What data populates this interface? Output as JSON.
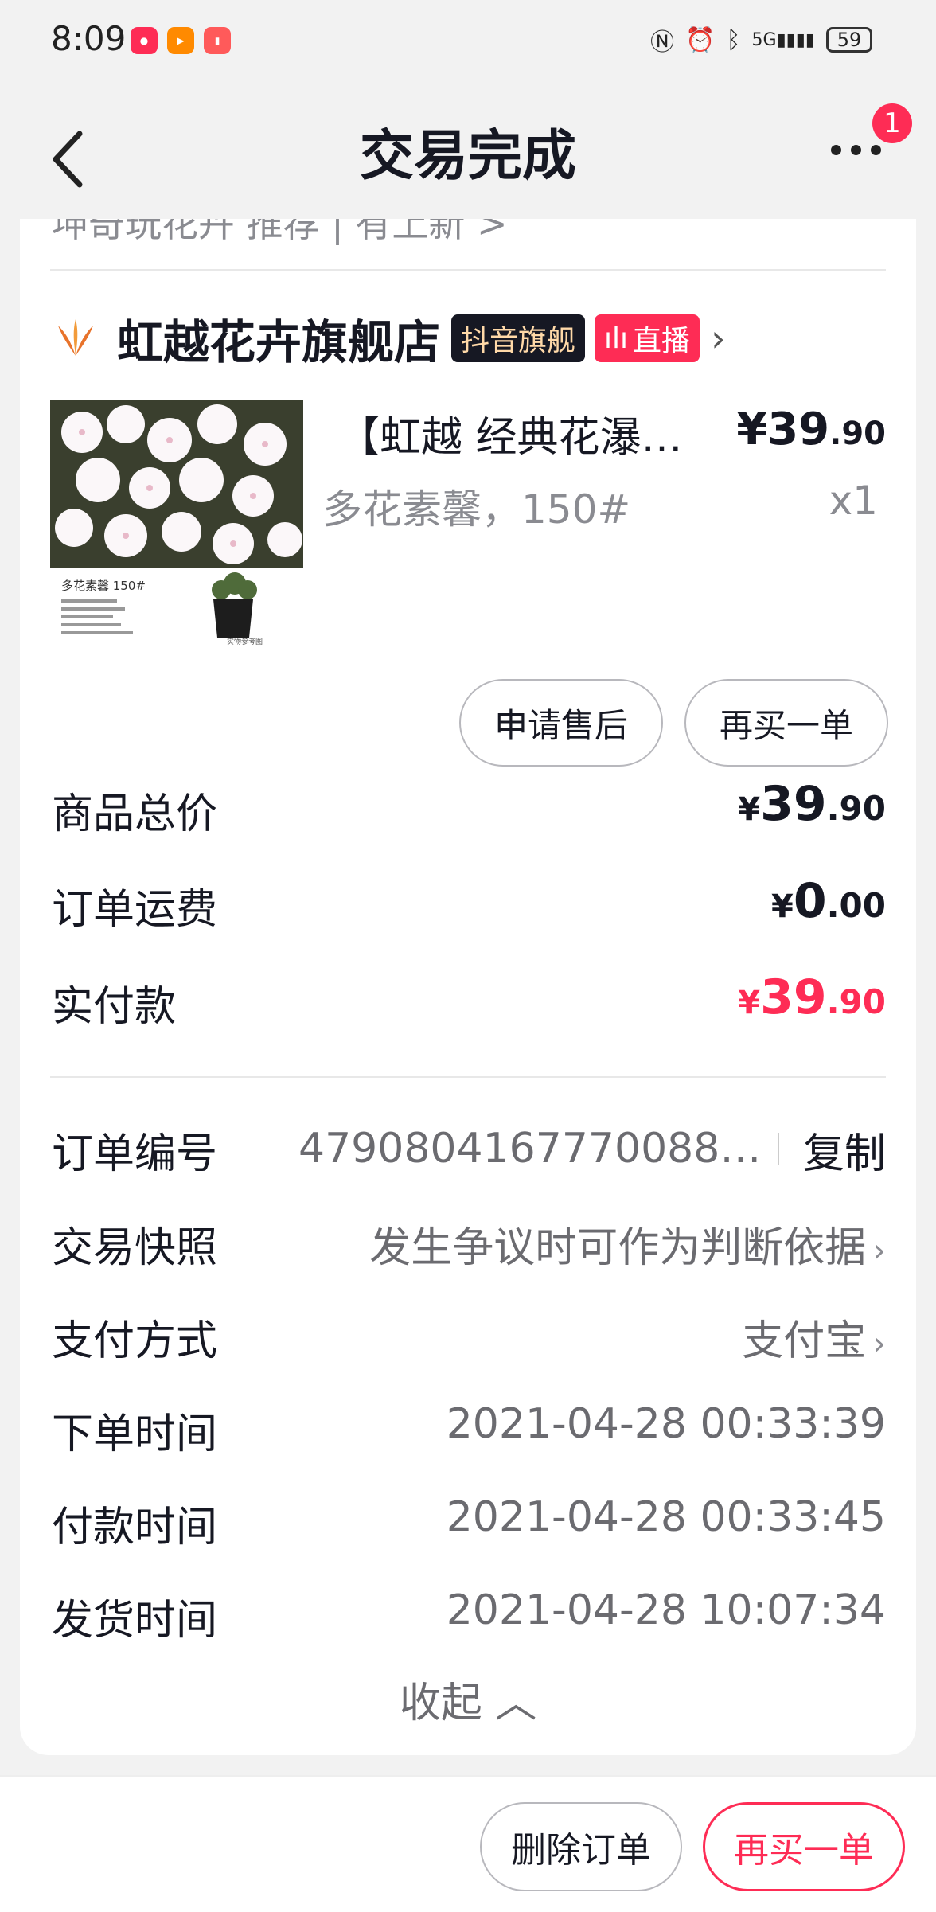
{
  "status_bar": {
    "time": "8:09",
    "battery": "59",
    "app_icons": [
      "red-app-icon",
      "video-app-icon",
      "book-app-icon"
    ],
    "sys_icons": [
      "nfc-icon",
      "alarm-icon",
      "bluetooth-icon",
      "signal-5g-icon"
    ],
    "signal_label": "5G"
  },
  "nav": {
    "title": "交易完成",
    "badge_count": "1"
  },
  "cut_row": "坤奇玩花卉 推荐 | 有上新 >",
  "shop": {
    "name": "虹越花卉旗舰店",
    "flag_tag": "抖音旗舰",
    "live_tag": "直播",
    "accent": "#fe2c55"
  },
  "product": {
    "title": "【虹越 经典花瀑…",
    "price_int": "¥39",
    "price_dec": ".90",
    "spec": "多花素馨，150#",
    "qty": "x1",
    "img_label": "多花素馨 150#",
    "img_note": "实物参考图"
  },
  "actions": {
    "after_sale": "申请售后",
    "buy_again": "再买一单"
  },
  "summary": [
    {
      "label": "商品总价",
      "yen": "¥",
      "int": "39",
      "dec": ".90"
    },
    {
      "label": "订单运费",
      "yen": "¥",
      "int": "0",
      "dec": ".00"
    },
    {
      "label": "实付款",
      "yen": "¥",
      "int": "39",
      "dec": ".90"
    }
  ],
  "info": {
    "order_no_label": "订单编号",
    "order_no": "4790804167770088…",
    "copy": "复制",
    "snapshot_label": "交易快照",
    "snapshot_value": "发生争议时可作为判断依据",
    "pay_method_label": "支付方式",
    "pay_method": "支付宝",
    "order_time_label": "下单时间",
    "order_time": "2021-04-28 00:33:39",
    "pay_time_label": "付款时间",
    "pay_time": "2021-04-28 00:33:45",
    "ship_time_label": "发货时间",
    "ship_time": "2021-04-28 10:07:34",
    "collapse": "收起"
  },
  "bottom": {
    "delete": "删除订单",
    "buy_again": "再买一单"
  }
}
